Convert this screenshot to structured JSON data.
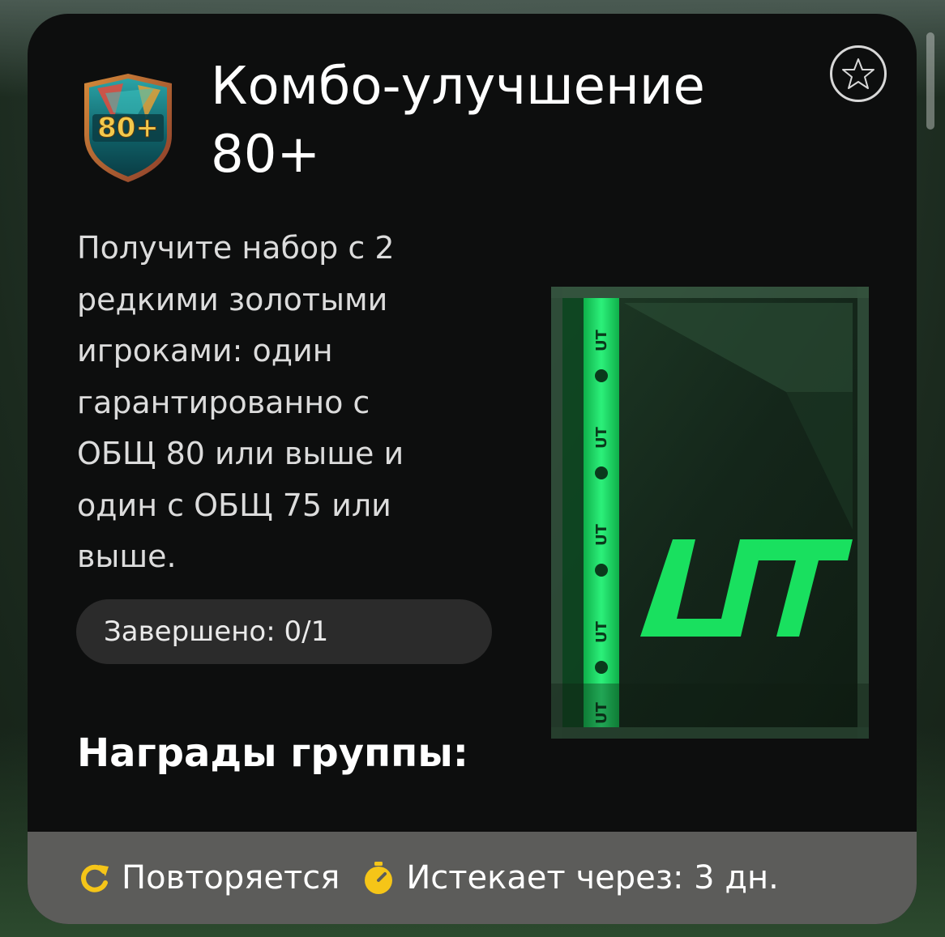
{
  "card": {
    "badge_text": "80+",
    "title": "Комбо-улучшение 80+",
    "description": "Получите набор с 2 редкими золотыми игроками: один гарантированно с ОБЩ 80 или выше и один с ОБЩ 75 или выше.",
    "progress_label": "Завершено: 0/1",
    "rewards_title": "Награды группы:",
    "pack_logo_text": "UT",
    "favorite_icon": "star-outline-icon"
  },
  "footer": {
    "repeat_label": "Повторяется",
    "repeat_icon": "refresh-icon",
    "expires_label": "Истекает через: 3 дн.",
    "expires_icon": "stopwatch-icon"
  },
  "colors": {
    "card_bg": "#0d0e0e",
    "footer_bg": "#5c5c5a",
    "pill_bg": "#2b2b2b",
    "accent_green": "#19e05f",
    "accent_yellow": "#f5c518",
    "badge_teal": "#0f5f66"
  }
}
